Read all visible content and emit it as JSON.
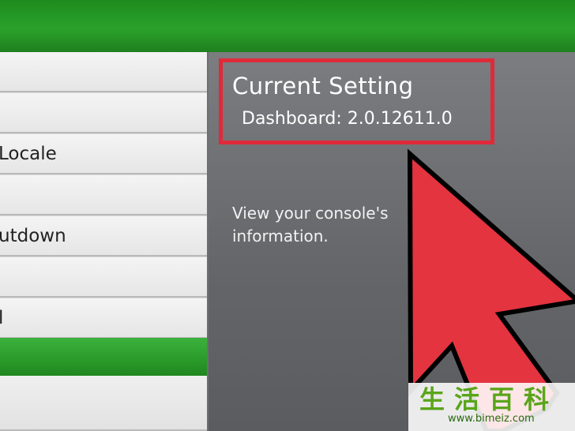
{
  "menu": {
    "items": [
      {
        "label": ""
      },
      {
        "label": ""
      },
      {
        "label": "Locale"
      },
      {
        "label": ""
      },
      {
        "label": "utdown"
      },
      {
        "label": ""
      },
      {
        "label": "l"
      },
      {
        "label": ""
      },
      {
        "label": ""
      }
    ]
  },
  "panel": {
    "current_setting_title": "Current Setting",
    "dashboard_version": "Dashboard: 2.0.12611.0",
    "description": "View your console's information."
  },
  "watermark": {
    "chars": "生活百科",
    "url": "www.bimeiz.com"
  },
  "colors": {
    "accent_green": "#2aa22a",
    "highlight_red": "#e02a3a"
  },
  "icons": {
    "pointer": "pointer-arrow-icon"
  }
}
